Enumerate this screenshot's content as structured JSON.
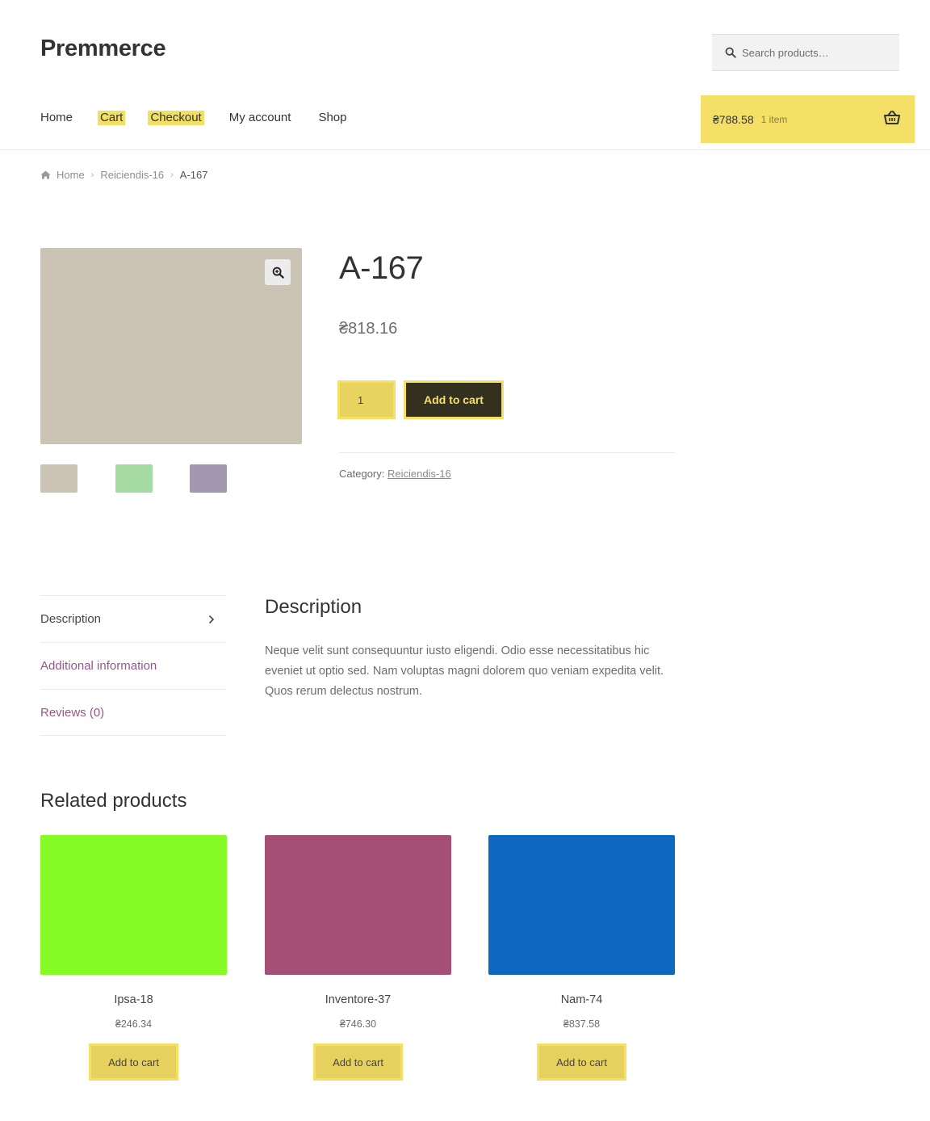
{
  "site": {
    "title": "Premmerce"
  },
  "search": {
    "placeholder": "Search products…",
    "icon": "search-icon"
  },
  "nav": {
    "items": [
      {
        "label": "Home",
        "highlighted": false
      },
      {
        "label": "Cart",
        "highlighted": true
      },
      {
        "label": "Checkout",
        "highlighted": true
      },
      {
        "label": "My account",
        "highlighted": false
      },
      {
        "label": "Shop",
        "highlighted": false
      }
    ]
  },
  "header_cart": {
    "amount": "₴788.58",
    "count": "1 item",
    "icon": "basket-icon"
  },
  "breadcrumb": {
    "home": "Home",
    "category": "Reiciendis-16",
    "current": "A-167"
  },
  "product": {
    "title": "A-167",
    "price": "₴818.16",
    "quantity": "1",
    "add_to_cart_label": "Add to cart",
    "category_label": "Category:",
    "category": "Reiciendis-16",
    "image_color": "#cbc3b4",
    "thumbnails": [
      "#cbc3b4",
      "#a5dba2",
      "#a497b0"
    ]
  },
  "tabs": [
    {
      "label": "Description",
      "active": true
    },
    {
      "label": "Additional information",
      "active": false
    },
    {
      "label": "Reviews (0)",
      "active": false
    }
  ],
  "description": {
    "heading": "Description",
    "text": "Neque velit sunt consequuntur iusto eligendi. Odio esse necessitatibus hic eveniet ut optio sed. Nam voluptas magni dolorem quo veniam expedita velit. Quos rerum delectus nostrum."
  },
  "related": {
    "heading": "Related products",
    "products": [
      {
        "name": "Ipsa-18",
        "price": "₴246.34",
        "color": "#86fc27",
        "button": "Add to cart"
      },
      {
        "name": "Inventore-37",
        "price": "₴746.30",
        "color": "#a54e76",
        "button": "Add to cart"
      },
      {
        "name": "Nam-74",
        "price": "₴837.58",
        "color": "#0f68c0",
        "button": "Add to cart"
      }
    ]
  },
  "colors": {
    "accent": "#f4e066",
    "dark_button": "#333020",
    "link": "#96588a"
  }
}
